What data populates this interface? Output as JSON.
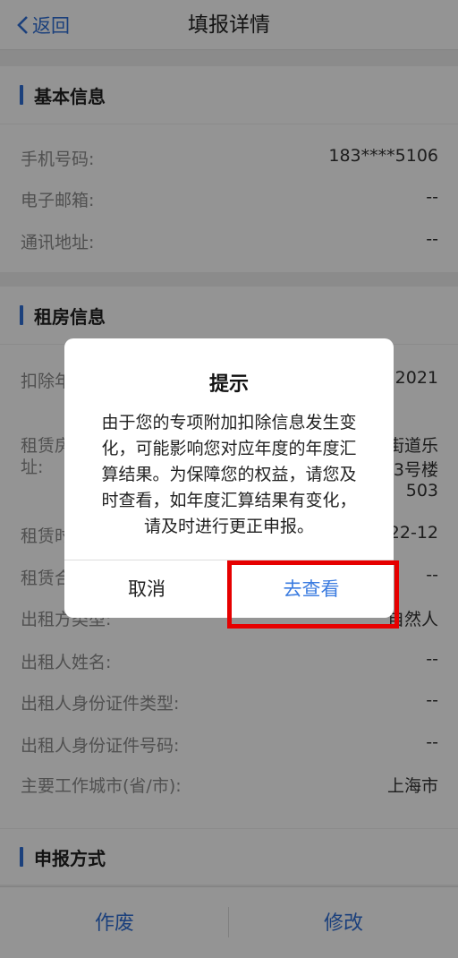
{
  "nav": {
    "back_label": "返回",
    "title": "填报详情"
  },
  "basic": {
    "title": "基本信息",
    "rows": [
      {
        "label": "手机号码:",
        "value": "183****5106"
      },
      {
        "label": "电子邮箱:",
        "value": "--"
      },
      {
        "label": "通讯地址:",
        "value": "--"
      }
    ]
  },
  "rent": {
    "title": "租房信息",
    "rows": [
      {
        "label": "扣除年",
        "value": "2021"
      },
      {
        "label": "租赁房",
        "label2": "址:",
        "value": "街道乐",
        "value2": "3号楼",
        "value3": "503"
      },
      {
        "label": "租赁时",
        "value": "22-12"
      },
      {
        "label": "租赁合",
        "value": "--"
      },
      {
        "label": "出租方类型:",
        "value": "自然人"
      },
      {
        "label": "出租人姓名:",
        "value": "--"
      },
      {
        "label": "出租人身份证件类型:",
        "value": "--"
      },
      {
        "label": "出租人身份证件号码:",
        "value": "--"
      },
      {
        "label": "主要工作城市(省/市):",
        "value": "上海市"
      }
    ]
  },
  "declare": {
    "title": "申报方式"
  },
  "bottom": {
    "void_label": "作废",
    "edit_label": "修改"
  },
  "dialog": {
    "title": "提示",
    "lines": [
      "由于您的专项附加扣除信息发生变",
      "化，可能影响您对应年度的年度汇",
      "算结果。为保障您的权益，请您及",
      "时查看，如年度汇算结果有变化，",
      "请及时进行更正申报。"
    ],
    "cancel_label": "取消",
    "view_label": "去查看"
  },
  "colors": {
    "accent": "#2f6fd6",
    "highlight": "#e60000"
  }
}
